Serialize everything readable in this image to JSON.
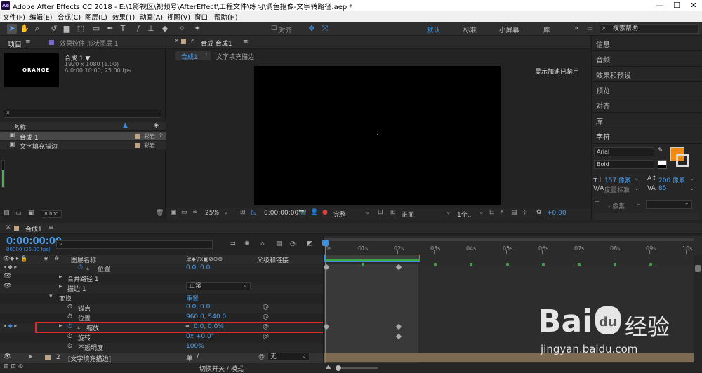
{
  "titlebar": {
    "app_icon": "Ae",
    "title": "Adobe After Effects CC 2018 - E:\\1影视区\\视频号\\AfterEffect\\工程文件\\练习\\调色抠像-文字转路径.aep *",
    "min": "—",
    "max": "☐",
    "close": "✕"
  },
  "menu": [
    "文件(F)",
    "编辑(E)",
    "合成(C)",
    "图层(L)",
    "效果(T)",
    "动画(A)",
    "视图(V)",
    "窗口",
    "帮助(H)"
  ],
  "toolbar": {
    "align_label": "对齐",
    "workspaces": [
      "默认",
      "标准",
      "小屏幕",
      "库"
    ],
    "search_placeholder": "搜索帮助"
  },
  "project": {
    "tab": "项目",
    "effects_tab": "效果控件 形状图层 1",
    "thumb_text": "ORANGE",
    "comp_name": "合成 1 ▼",
    "comp_size": "1920 x 1080 (1.00)",
    "comp_duration": "Δ 0:00:10:00, 25.00 fps",
    "col_name": "名称",
    "items": [
      {
        "name": "合成 1",
        "label": "彩岩"
      },
      {
        "name": "文字填充描边",
        "label": "彩岩"
      }
    ],
    "bpc": "8 bpc"
  },
  "comp_panel": {
    "tab_prefix": "6",
    "tab": "合成 合成1",
    "breadcrumb_active": "合成1",
    "breadcrumb_next": "文字填充描边",
    "accel_msg": "显示加速已禁用",
    "zoom": "25%",
    "timecode": "0:00:00:00",
    "quality": "完整",
    "view": "正面",
    "views": "1个..",
    "offset": "+0.00"
  },
  "right_panel": {
    "items": [
      "信息",
      "音频",
      "效果和预设",
      "预览",
      "对齐",
      "库"
    ],
    "char_title": "字符",
    "font": "Arial",
    "style": "Bold",
    "font_size": "157 像素",
    "leading": "200 像素",
    "kerning": "度量标准",
    "tracking": "85",
    "units": "- 像素"
  },
  "timeline": {
    "tab": "合成1",
    "timecode": "0:00:00:00",
    "timecode_sub": "00000 (25.00 fps)",
    "col_layer": "图层名称",
    "col_parent": "父级和链接",
    "col_switches": "单◆\\fx▣⊘⊙⊚",
    "ruler": [
      "0s",
      "01s",
      "02s",
      "03s",
      "04s",
      "05s",
      "06s",
      "07s",
      "08s",
      "09s",
      "10s"
    ],
    "rows": [
      {
        "name": "位置",
        "value": "0.0, 0.0"
      },
      {
        "name": "合并路径 1",
        "value": ""
      },
      {
        "name": "描边 1",
        "value": "正常"
      },
      {
        "name": "变换",
        "value": "重置"
      },
      {
        "name": "锚点",
        "value": "0.0, 0.0"
      },
      {
        "name": "位置",
        "value": "960.0, 540.0"
      },
      {
        "name": "缩放",
        "value": "0.0, 0.0%"
      },
      {
        "name": "旋转",
        "value": "0x +0.0°"
      },
      {
        "name": "不透明度",
        "value": "100%"
      }
    ],
    "layer2": {
      "num": "2",
      "name": "[文字填充描边]",
      "parent": "无"
    },
    "footer": "切换开关 / 模式"
  },
  "watermark": {
    "brand": "Bai",
    "paw": "du",
    "cn": "经验",
    "url": "jingyan.baidu.com"
  }
}
